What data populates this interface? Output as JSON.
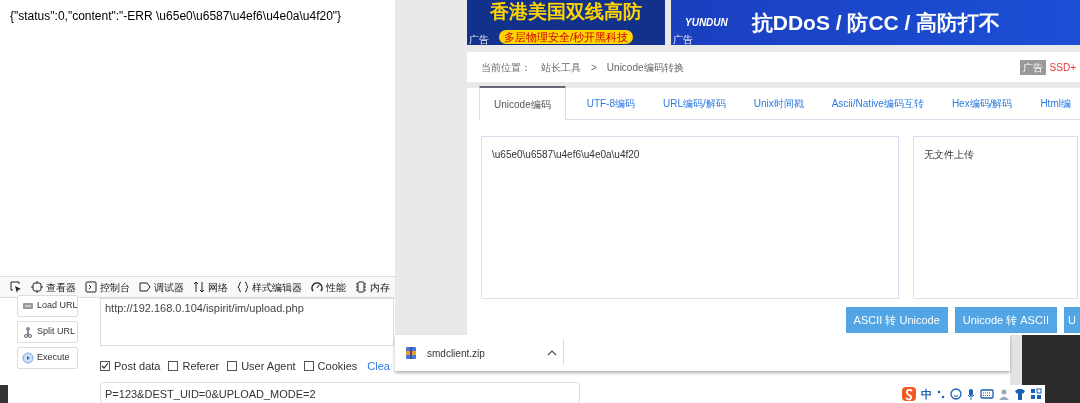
{
  "response_text": "{\"status\":0,\"content\":\"-ERR \\u65e0\\u6587\\u4ef6\\u4e0a\\u4f20\"}",
  "devtools": {
    "tabs": [
      {
        "label": "查看器",
        "kind": "inspector"
      },
      {
        "label": "控制台",
        "kind": "console"
      },
      {
        "label": "调试器",
        "kind": "debugger"
      },
      {
        "label": "网络",
        "kind": "network"
      },
      {
        "label": "样式编辑器",
        "kind": "style"
      },
      {
        "label": "性能",
        "kind": "performance"
      },
      {
        "label": "内存",
        "kind": "memory"
      }
    ]
  },
  "hackbar": {
    "buttons": [
      {
        "label": "Load URL",
        "kind": "load"
      },
      {
        "label": "Split URL",
        "kind": "split"
      },
      {
        "label": "Execute",
        "kind": "execute"
      }
    ],
    "url": "http://192.168.0.104/ispirit/im/upload.php",
    "options": [
      {
        "label": "Post data",
        "checked": true
      },
      {
        "label": "Referer",
        "checked": false
      },
      {
        "label": "User Agent",
        "checked": false
      },
      {
        "label": "Cookies",
        "checked": false
      }
    ],
    "clear_link": "Clea",
    "post_data": "P=123&DEST_UID=0&UPLOAD_MODE=2"
  },
  "ads": [
    {
      "headline": "香港美国双线高防",
      "subline": "多层物理安全/秒开黑科技",
      "tag": "广告"
    },
    {
      "brand": "YUNDUN",
      "headline": "抗DDoS / 防CC / 高防打不",
      "tag": "广告"
    }
  ],
  "breadcrumb": {
    "label": "当前位置：",
    "items": [
      "站长工具",
      "Unicode编码转换"
    ],
    "separator": ">",
    "ad_tag": "广告",
    "ad_text": "SSD+"
  },
  "tabs": [
    {
      "label": "Unicode编码",
      "selected": true
    },
    {
      "label": "UTF-8编码",
      "selected": false
    },
    {
      "label": "URL编码/解码",
      "selected": false
    },
    {
      "label": "Unix时间戳",
      "selected": false
    },
    {
      "label": "Ascii/Native编码互转",
      "selected": false
    },
    {
      "label": "Hex编码/解码",
      "selected": false
    },
    {
      "label": "Html编",
      "selected": false
    }
  ],
  "input_text": "\\u65e0\\u6587\\u4ef6\\u4e0a\\u4f20",
  "output_text": "无文件上传",
  "actions": [
    "ASCII 转 Unicode",
    "Unicode 转 ASCII",
    "U"
  ],
  "download": {
    "filename": "smdclient.zip"
  },
  "ime": {
    "mode": "中"
  }
}
